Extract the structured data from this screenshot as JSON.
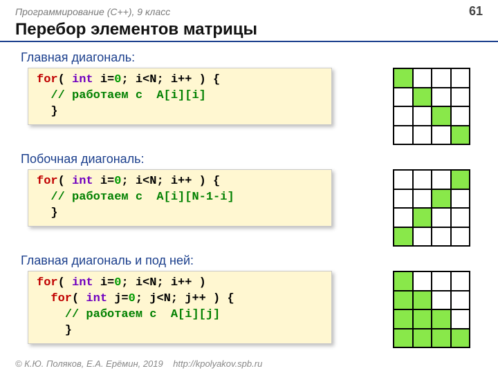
{
  "header": {
    "course": "Программирование (C++), 9 класс",
    "page": "61"
  },
  "title": "Перебор элементов матрицы",
  "sections": [
    {
      "label": "Главная диагональ:",
      "code": {
        "l1a": "for",
        "l1b": "( ",
        "l1c": "int",
        "l1d": " i=",
        "l1z": "0",
        "l1e": "; i<N; i++ ) {",
        "l2a": "  ",
        "l2c": "// работаем с  A[i][i]",
        "l3": "  }"
      },
      "matrix": [
        "1000",
        "0100",
        "0010",
        "0001"
      ]
    },
    {
      "label": "Побочная диагональ:",
      "code": {
        "l1a": "for",
        "l1b": "( ",
        "l1c": "int",
        "l1d": " i=",
        "l1z": "0",
        "l1e": "; i<N; i++ ) {",
        "l2a": "  ",
        "l2c": "// работаем с  A[i][N-1-i]",
        "l3": "  }"
      },
      "matrix": [
        "0001",
        "0010",
        "0100",
        "1000"
      ]
    },
    {
      "label": "Главная диагональ и под ней:",
      "code": {
        "l1a": "for",
        "l1b": "( ",
        "l1c": "int",
        "l1d": " i=",
        "l1z": "0",
        "l1e": "; i<N; i++ )",
        "l2a": "  ",
        "l2b": "for",
        "l2bb": "( ",
        "l2c": "int",
        "l2d": " j=",
        "l2z": "0",
        "l2e": "; j<N; j++ ) {",
        "l3a": "    ",
        "l3c": "// работаем с  A[i][j]",
        "l4": "    }"
      },
      "matrix": [
        "1000",
        "1100",
        "1110",
        "1111"
      ]
    }
  ],
  "footer": {
    "copy": "© К.Ю. Поляков, Е.А. Ерёмин, 2019",
    "url": "http://kpolyakov.spb.ru"
  }
}
